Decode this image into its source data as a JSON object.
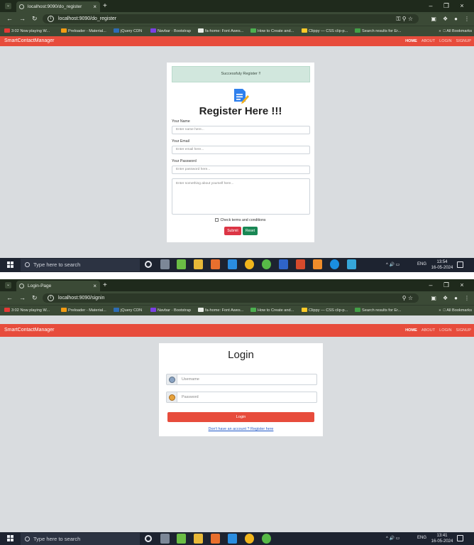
{
  "colors": {
    "app_navbar": "#e74c3c",
    "success_alert": "#d1e7dd",
    "submit": "#dc3545",
    "reset": "#198754",
    "login_button": "#e74c3c",
    "link": "#2158c8"
  },
  "icons": {
    "tab_favicon": "globe-icon",
    "site_info": "info-icon",
    "register_logo": "document-pen-icon",
    "username_addon": "user-avatar-icon",
    "password_addon": "lock-icon",
    "start": "windows-logo-icon",
    "search": "search-icon"
  },
  "bookmarks": [
    "3:02 Now playing W...",
    "Preloader - Material...",
    "jQuery CDN",
    "Navbar · Bootstrap",
    "fa-home: Font Awes...",
    "How to Create and...",
    "Clippy — CSS clip-p...",
    "Search results for Er..."
  ],
  "bookmarks_bottom": [
    "3:02 Now playing W...",
    "Preloader - Material...",
    "jQuery CDN",
    "Navbar · Bootstrap",
    "fa-home: Font Awes...",
    "How to Create and...",
    "Clippy — CSS clip-p...",
    "Search results for Er..."
  ],
  "bookmarks_overflow": "»",
  "all_bookmarks": "All Bookmarks",
  "brand": "SmartContactManager",
  "nav": {
    "home": "HOME",
    "about": "ABOUT",
    "login": "LOGIN",
    "signup": "SIGNUP"
  },
  "register_screen": {
    "tab_title": "localhost:9090/do_register",
    "url": "localhost:9090/do_register",
    "alert": "Successfuly Register !!",
    "title": "Register Here !!!",
    "name_label": "Your Name",
    "name_placeholder": "Enter name here...",
    "email_label": "Your Email",
    "email_placeholder": "Enter email here...",
    "password_label": "Your Password",
    "password_placeholder": "Enter password here...",
    "about_placeholder": "Enter something about yourself here...",
    "terms": "Check terms and conditions",
    "submit": "Submit",
    "reset": "Reset",
    "clock_time": "13:54",
    "clock_date": "16-05-2024"
  },
  "login_screen": {
    "tab_title": "Login-Page",
    "url": "localhost:9090/signin",
    "title": "Login",
    "username_placeholder": "Username",
    "password_placeholder": "Password",
    "login": "Login",
    "register_link": "Don't have an account ? Register here",
    "clock_time": "13:41",
    "clock_date": "16-05-2024"
  },
  "taskbar": {
    "search_placeholder": "Type here to search",
    "language": "ENG"
  }
}
